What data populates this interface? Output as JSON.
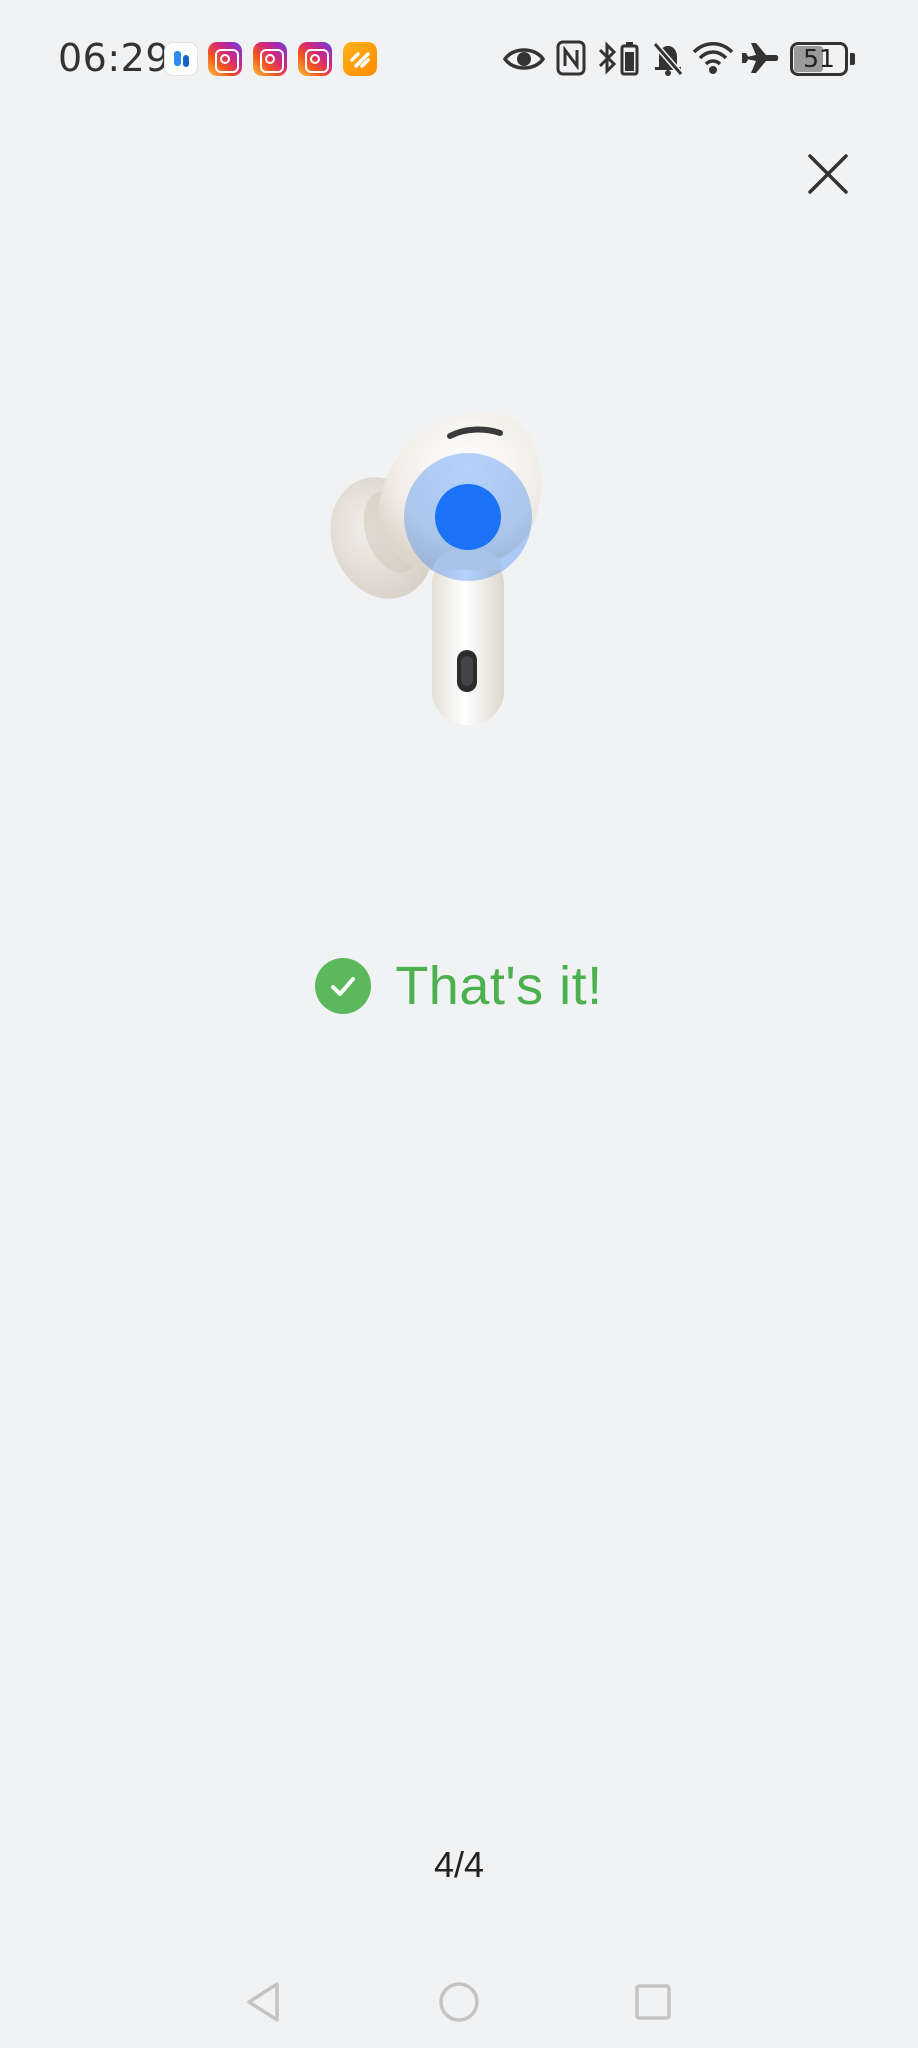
{
  "status_bar": {
    "time": "06:29",
    "notification_icons": [
      "app-notification-icon",
      "instagram-icon",
      "instagram-icon",
      "instagram-icon",
      "orange-app-icon"
    ],
    "system_icons": [
      "eye-icon",
      "nfc-icon",
      "bluetooth-battery-icon",
      "bell-muted-icon",
      "wifi-icon",
      "airplane-icon",
      "battery-icon"
    ],
    "battery_level": "51"
  },
  "header": {
    "close_icon": "close-icon"
  },
  "illustration": {
    "name": "earbud-illustration",
    "highlight_color": "#1a73f5",
    "earbud_color": "#f3f0ea"
  },
  "result": {
    "message": "That's it!",
    "icon": "check-circle-icon",
    "color": "#4cb04e"
  },
  "pager": {
    "label": "4/4"
  },
  "nav_bar": {
    "buttons": [
      "back-icon",
      "home-icon",
      "recent-apps-icon"
    ]
  }
}
